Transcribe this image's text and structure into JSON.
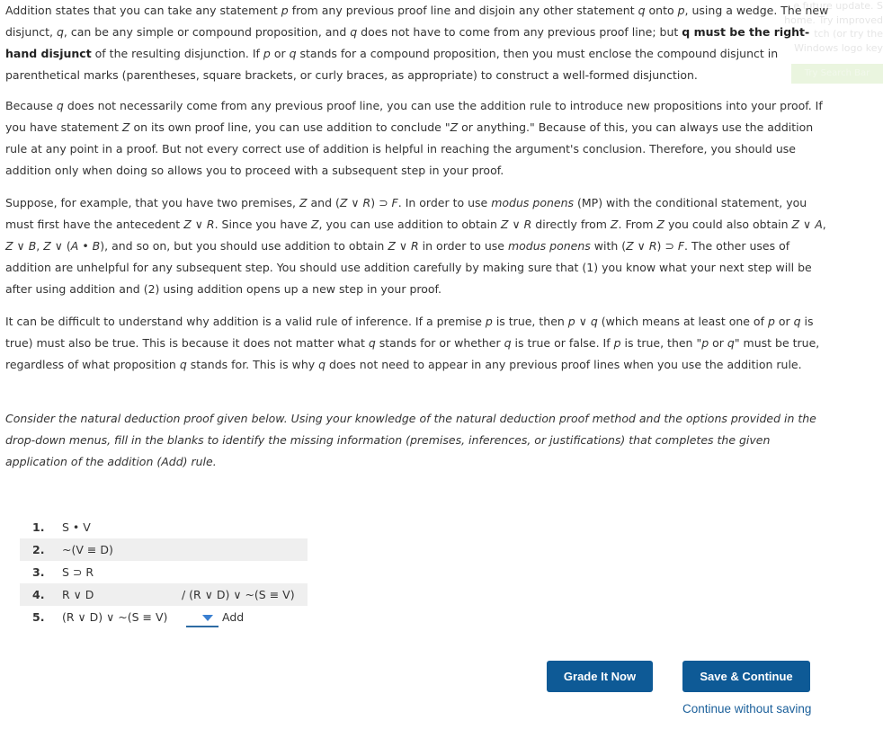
{
  "paragraphs": {
    "p1": [
      {
        "t": "Addition states that you can take any statement "
      },
      {
        "t": "p",
        "i": true
      },
      {
        "t": " from any previous proof line and disjoin any other statement "
      },
      {
        "t": "q",
        "i": true
      },
      {
        "t": " onto "
      },
      {
        "t": "p",
        "i": true
      },
      {
        "t": ", using a wedge. The new disjunct, "
      },
      {
        "t": "q",
        "i": true
      },
      {
        "t": ", can be any simple or compound proposition, and "
      },
      {
        "t": "q",
        "i": true
      },
      {
        "t": " does not have to come from any previous proof line; but "
      },
      {
        "t": "q must be the right-hand disjunct",
        "b": true
      },
      {
        "t": " of the resulting disjunction. If "
      },
      {
        "t": "p",
        "i": true
      },
      {
        "t": " or "
      },
      {
        "t": "q",
        "i": true
      },
      {
        "t": " stands for a compound proposition, then you must enclose the compound disjunct in parenthetical marks (parentheses, square brackets, or curly braces, as appropriate) to construct a well-formed disjunction."
      }
    ],
    "p2": [
      {
        "t": "Because "
      },
      {
        "t": "q",
        "i": true
      },
      {
        "t": " does not necessarily come from any previous proof line, you can use the addition rule to introduce new propositions into your proof. If you have statement "
      },
      {
        "t": "Z",
        "i": true
      },
      {
        "t": " on its own proof line, you can use addition to conclude \""
      },
      {
        "t": "Z",
        "i": true
      },
      {
        "t": " or anything.\" Because of this, you can always use the addition rule at any point in a proof. But not every correct use of addition is helpful in reaching the argument's conclusion. Therefore, you should use addition only when doing so allows you to proceed with a subsequent step in your proof."
      }
    ],
    "p3": [
      {
        "t": "Suppose, for example, that you have two premises, "
      },
      {
        "t": "Z",
        "i": true
      },
      {
        "t": " and ("
      },
      {
        "t": "Z",
        "i": true
      },
      {
        "t": " ∨ "
      },
      {
        "t": "R",
        "i": true
      },
      {
        "t": ") ⊃ "
      },
      {
        "t": "F",
        "i": true
      },
      {
        "t": ". In order to use "
      },
      {
        "t": "modus ponens",
        "i": true
      },
      {
        "t": " (MP) with the conditional statement, you must first have the antecedent "
      },
      {
        "t": "Z",
        "i": true
      },
      {
        "t": " ∨ "
      },
      {
        "t": "R",
        "i": true
      },
      {
        "t": ". Since you have "
      },
      {
        "t": "Z",
        "i": true
      },
      {
        "t": ", you can use addition to obtain "
      },
      {
        "t": "Z",
        "i": true
      },
      {
        "t": " ∨ "
      },
      {
        "t": "R",
        "i": true
      },
      {
        "t": " directly from "
      },
      {
        "t": "Z",
        "i": true
      },
      {
        "t": ". From "
      },
      {
        "t": "Z",
        "i": true
      },
      {
        "t": " you could also obtain "
      },
      {
        "t": "Z",
        "i": true
      },
      {
        "t": " ∨ "
      },
      {
        "t": "A",
        "i": true
      },
      {
        "t": ", "
      },
      {
        "t": "Z",
        "i": true
      },
      {
        "t": " ∨ "
      },
      {
        "t": "B",
        "i": true
      },
      {
        "t": ", "
      },
      {
        "t": "Z",
        "i": true
      },
      {
        "t": " ∨ ("
      },
      {
        "t": "A",
        "i": true
      },
      {
        "t": " • "
      },
      {
        "t": "B",
        "i": true
      },
      {
        "t": "), and so on, but you should use addition to obtain "
      },
      {
        "t": "Z",
        "i": true
      },
      {
        "t": " ∨ "
      },
      {
        "t": "R",
        "i": true
      },
      {
        "t": " in order to use "
      },
      {
        "t": "modus ponens",
        "i": true
      },
      {
        "t": " with ("
      },
      {
        "t": "Z",
        "i": true
      },
      {
        "t": " ∨ "
      },
      {
        "t": "R",
        "i": true
      },
      {
        "t": ") ⊃ "
      },
      {
        "t": "F",
        "i": true
      },
      {
        "t": ". The other uses of addition are unhelpful for any subsequent step. You should use addition carefully by making sure that (1) you know what your next step will be after using addition and (2) using addition opens up a new step in your proof."
      }
    ],
    "p4": [
      {
        "t": "It can be difficult to understand why addition is a valid rule of inference. If a premise "
      },
      {
        "t": "p",
        "i": true
      },
      {
        "t": " is true, then "
      },
      {
        "t": "p",
        "i": true
      },
      {
        "t": " ∨ "
      },
      {
        "t": "q",
        "i": true
      },
      {
        "t": " (which means at least one of "
      },
      {
        "t": "p",
        "i": true
      },
      {
        "t": " or "
      },
      {
        "t": "q",
        "i": true
      },
      {
        "t": " is true) must also be true. This is because it does not matter what "
      },
      {
        "t": "q",
        "i": true
      },
      {
        "t": " stands for or whether "
      },
      {
        "t": "q",
        "i": true
      },
      {
        "t": " is true or false. If "
      },
      {
        "t": "p",
        "i": true
      },
      {
        "t": " is true, then \""
      },
      {
        "t": "p",
        "i": true
      },
      {
        "t": " or "
      },
      {
        "t": "q",
        "i": true
      },
      {
        "t": "\" must be true, regardless of what proposition "
      },
      {
        "t": "q",
        "i": true
      },
      {
        "t": " stands for. This is why "
      },
      {
        "t": "q",
        "i": true
      },
      {
        "t": " does not need to appear in any previous proof lines when you use the addition rule."
      }
    ],
    "p5": [
      {
        "t": "Consider the natural deduction proof given below. Using your knowledge of the natural deduction proof method and the options provided in the drop-down menus, fill in the blanks to identify the missing information (premises, inferences, or justifications) that completes the given application of the addition (Add) rule."
      }
    ]
  },
  "ghost": {
    "line1": "e future update. S",
    "line2": "home. Try improved",
    "line3": "tch (or try the",
    "line4": "Windows logo key",
    "button": "Try Search Bar"
  },
  "proof": {
    "lines": [
      {
        "num": "1.",
        "premise": "S • V",
        "justification": ""
      },
      {
        "num": "2.",
        "premise": "~(V ≡ D)",
        "justification": ""
      },
      {
        "num": "3.",
        "premise": "S ⊃ R",
        "justification": ""
      },
      {
        "num": "4.",
        "premise": "R ∨ D",
        "justification": "/ (R ∨ D) ∨ ~(S ≡ V)"
      },
      {
        "num": "5.",
        "premise": "(R ∨ D) ∨ ~(S ≡ V)",
        "justification": ""
      }
    ],
    "dropdown_icon": "chevron-down-icon",
    "rule_label": "Add"
  },
  "buttons": {
    "grade": "Grade It Now",
    "save": "Save & Continue",
    "continue_link": "Continue without saving"
  },
  "colors": {
    "button_bg": "#0e5a96",
    "link": "#1a5f9a",
    "row_shade": "#efefef"
  }
}
